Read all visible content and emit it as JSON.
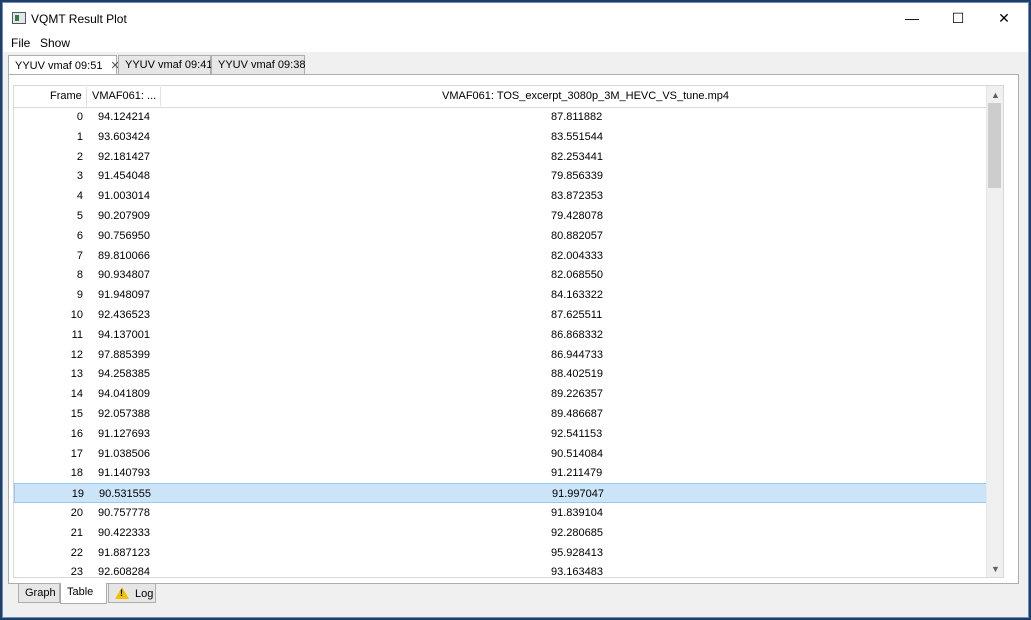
{
  "window": {
    "title": "VQMT Result Plot"
  },
  "window_controls": {
    "minimize": "—",
    "maximize": "☐",
    "close": "✕"
  },
  "menu": {
    "items": [
      "File",
      "Show"
    ]
  },
  "tabs": [
    {
      "label": "YYUV vmaf 09:51",
      "close": "✕"
    },
    {
      "label": "YYUV vmaf 09:41"
    },
    {
      "label": "YYUV vmaf 09:38"
    }
  ],
  "table": {
    "columns": [
      "Frame",
      "VMAF061: ...",
      "VMAF061: TOS_excerpt_3080p_3M_HEVC_VS_tune.mp4"
    ],
    "selected_row": 19,
    "rows": [
      [
        "0",
        "94.124214",
        "87.811882"
      ],
      [
        "1",
        "93.603424",
        "83.551544"
      ],
      [
        "2",
        "92.181427",
        "82.253441"
      ],
      [
        "3",
        "91.454048",
        "79.856339"
      ],
      [
        "4",
        "91.003014",
        "83.872353"
      ],
      [
        "5",
        "90.207909",
        "79.428078"
      ],
      [
        "6",
        "90.756950",
        "80.882057"
      ],
      [
        "7",
        "89.810066",
        "82.004333"
      ],
      [
        "8",
        "90.934807",
        "82.068550"
      ],
      [
        "9",
        "91.948097",
        "84.163322"
      ],
      [
        "10",
        "92.436523",
        "87.625511"
      ],
      [
        "11",
        "94.137001",
        "86.868332"
      ],
      [
        "12",
        "97.885399",
        "86.944733"
      ],
      [
        "13",
        "94.258385",
        "88.402519"
      ],
      [
        "14",
        "94.041809",
        "89.226357"
      ],
      [
        "15",
        "92.057388",
        "89.486687"
      ],
      [
        "16",
        "91.127693",
        "92.541153"
      ],
      [
        "17",
        "91.038506",
        "90.514084"
      ],
      [
        "18",
        "91.140793",
        "91.211479"
      ],
      [
        "19",
        "90.531555",
        "91.997047"
      ],
      [
        "20",
        "90.757778",
        "91.839104"
      ],
      [
        "21",
        "90.422333",
        "92.280685"
      ],
      [
        "22",
        "91.887123",
        "95.928413"
      ],
      [
        "23",
        "92.608284",
        "93.163483"
      ]
    ]
  },
  "scrollbar": {
    "up": "▲",
    "down": "▼"
  },
  "bottom_tabs": [
    "Graph",
    "Table",
    "Log"
  ],
  "active_bottom_tab": "Table"
}
